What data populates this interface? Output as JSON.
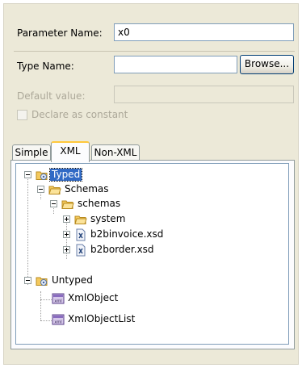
{
  "form": {
    "param_name_label": "Parameter Name:",
    "param_name_value": "x0",
    "type_name_label": "Type Name:",
    "type_name_value": "",
    "browse_label": "Browse...",
    "default_value_label": "Default value:",
    "default_value_value": "",
    "declare_constant_label": "Declare as constant",
    "declare_constant_checked": false
  },
  "tabs": [
    {
      "label": "Simple",
      "active": false
    },
    {
      "label": "XML",
      "active": true
    },
    {
      "label": "Non-XML",
      "active": false
    }
  ],
  "tree": {
    "typed": "Typed",
    "schemas_group": "Schemas",
    "schemas_folder": "schemas",
    "system": "system",
    "file1": "b2binvoice.xsd",
    "file2": "b2border.xsd",
    "untyped": "Untyped",
    "xml_object": "XmlObject",
    "xml_object_list": "XmlObjectList"
  },
  "colors": {
    "selection": "#316ac5",
    "active_tab_accent": "#ffc83c",
    "folder": "#f4c95d"
  }
}
